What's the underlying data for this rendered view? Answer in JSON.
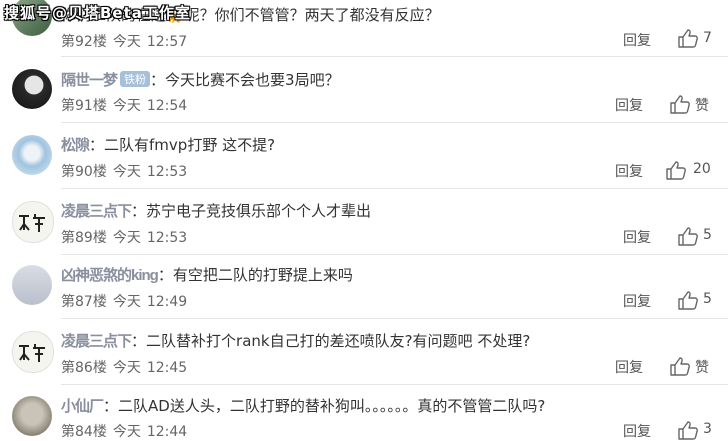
{
  "watermark": "搜狐号@贝塔Beta工作室",
  "reply_label": "回复",
  "comments": [
    {
      "username": "",
      "badge": "",
      "text": "你们二队的在送🐆呢？你们不管管？两天了都没有反应？",
      "floor": "第92楼",
      "day": "今天",
      "time": "12:57",
      "likes": "7"
    },
    {
      "username": "隔世一梦",
      "badge": "铁粉",
      "text": "今天比赛不会也要3局吧？",
      "floor": "第91楼",
      "day": "今天",
      "time": "12:54",
      "likes": "赞"
    },
    {
      "username": "松隙",
      "badge": "",
      "text": "二队有fmvp打野  这不提?",
      "floor": "第90楼",
      "day": "今天",
      "time": "12:53",
      "likes": "20"
    },
    {
      "username": "凌晨三点下",
      "badge": "",
      "text": "苏宁电子竞技俱乐部个个人才辈出",
      "floor": "第89楼",
      "day": "今天",
      "time": "12:53",
      "likes": "5"
    },
    {
      "username": "凶神恶煞的king",
      "badge": "",
      "text": "有空把二队的打野提上来吗",
      "floor": "第87楼",
      "day": "今天",
      "time": "12:49",
      "likes": "5"
    },
    {
      "username": "凌晨三点下",
      "badge": "",
      "text": "二队替补打个rank自己打的差还喷队友?有问题吧 不处理?",
      "floor": "第86楼",
      "day": "今天",
      "time": "12:45",
      "likes": "赞"
    },
    {
      "username": "小仙厂",
      "badge": "",
      "text": "二队AD送人头，二队打野的替补狗叫。。。。。。真的不管管二队吗?",
      "floor": "第84楼",
      "day": "今天",
      "time": "12:44",
      "likes": "3"
    }
  ]
}
